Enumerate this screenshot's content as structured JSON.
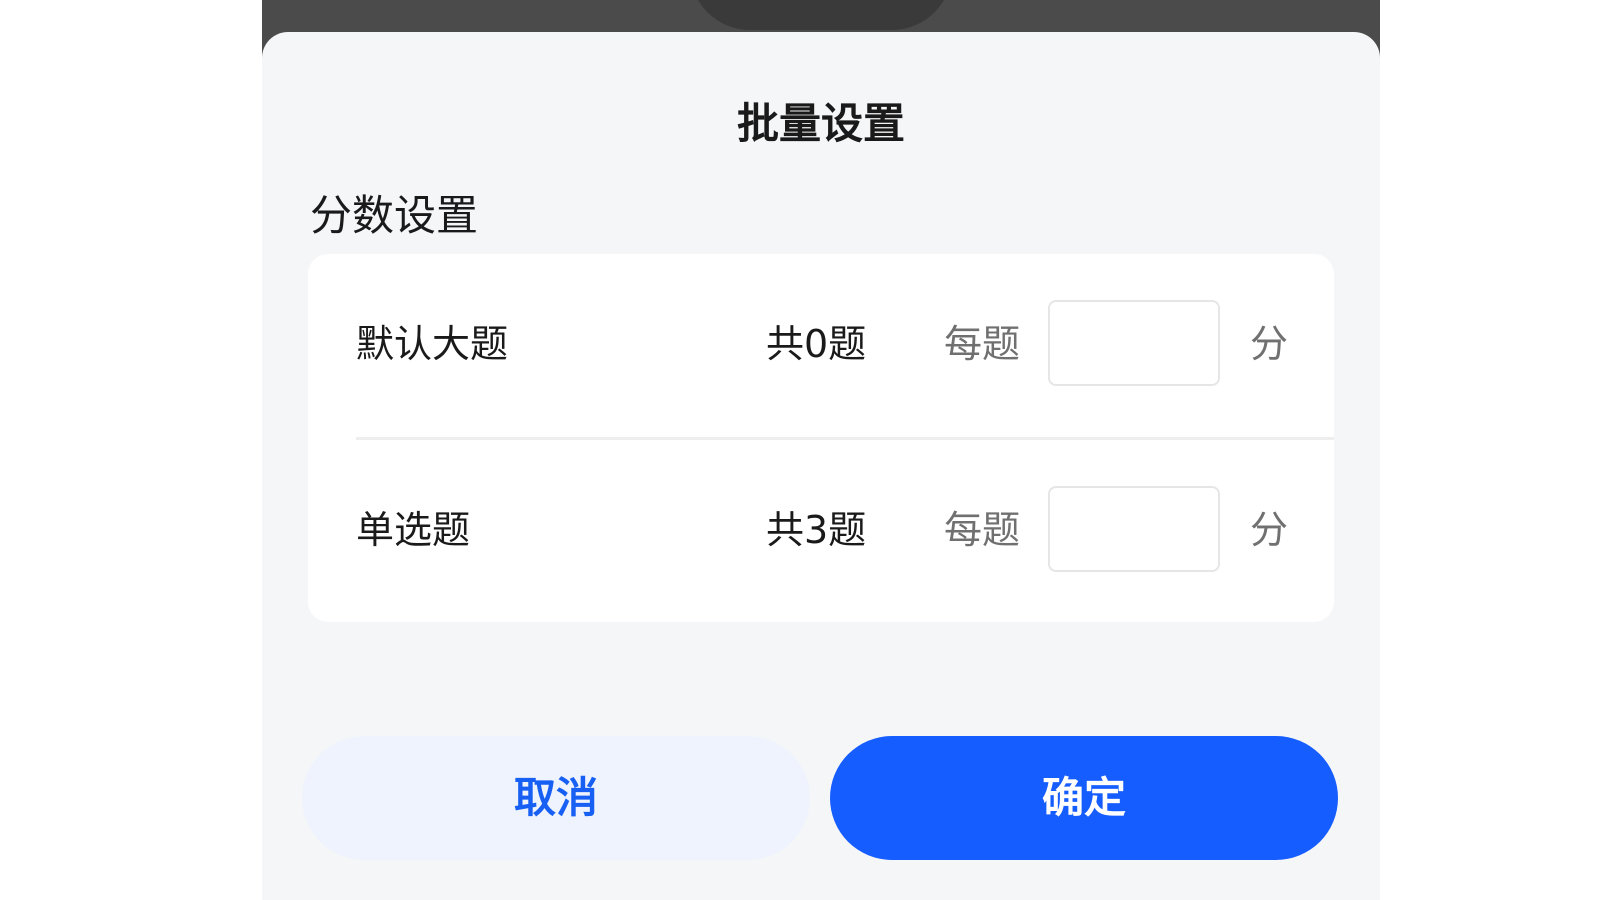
{
  "dialog": {
    "title": "批量设置",
    "section_title": "分数设置"
  },
  "rows": [
    {
      "name": "默认大题",
      "count": "共0题",
      "per_label": "每题",
      "score_value": "",
      "unit": "分"
    },
    {
      "name": "单选题",
      "count": "共3题",
      "per_label": "每题",
      "score_value": "",
      "unit": "分"
    }
  ],
  "buttons": {
    "cancel": "取消",
    "confirm": "确定"
  },
  "colors": {
    "primary": "#165dff",
    "cancel_bg": "#eef3fd",
    "sheet_bg": "#f5f6f8"
  }
}
